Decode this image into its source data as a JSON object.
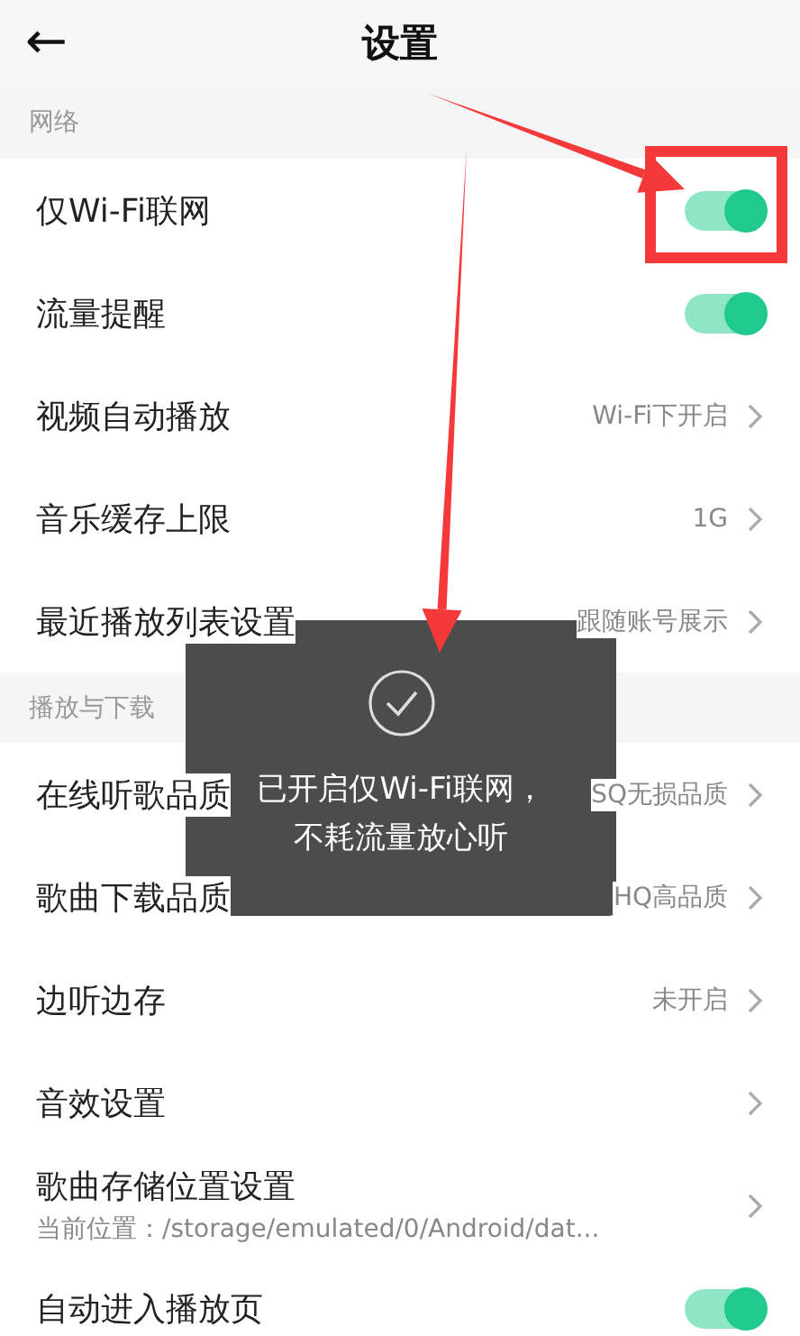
{
  "header": {
    "back_icon": "←",
    "title": "设置"
  },
  "sections": [
    {
      "title": "网络",
      "rows": [
        {
          "kind": "toggle",
          "label": "仅Wi-Fi联网",
          "on": true
        },
        {
          "kind": "toggle",
          "label": "流量提醒",
          "on": true
        },
        {
          "kind": "link",
          "label": "视频自动播放",
          "value": "Wi-Fi下开启"
        },
        {
          "kind": "link",
          "label": "音乐缓存上限",
          "value": "1G"
        },
        {
          "kind": "link",
          "label": "最近播放列表设置",
          "value": "跟随账号展示"
        }
      ]
    },
    {
      "title": "播放与下载",
      "rows": [
        {
          "kind": "link",
          "label": "在线听歌品质",
          "value": "SQ无损品质"
        },
        {
          "kind": "link",
          "label": "歌曲下载品质",
          "value": "HQ高品质"
        },
        {
          "kind": "link",
          "label": "边听边存",
          "value": "未开启"
        },
        {
          "kind": "link",
          "label": "音效设置"
        },
        {
          "kind": "link",
          "label": "歌曲存储位置设置",
          "sublabel": "当前位置：/storage/emulated/0/Android/dat..."
        },
        {
          "kind": "toggle",
          "label": "自动进入播放页",
          "on": true
        }
      ]
    }
  ],
  "toast": {
    "lines": [
      "已开启仅Wi-Fi联网，",
      "不耗流量放心听"
    ]
  },
  "annotations": [
    {
      "kind": "box"
    },
    {
      "kind": "arrow"
    },
    {
      "kind": "arrow"
    }
  ]
}
